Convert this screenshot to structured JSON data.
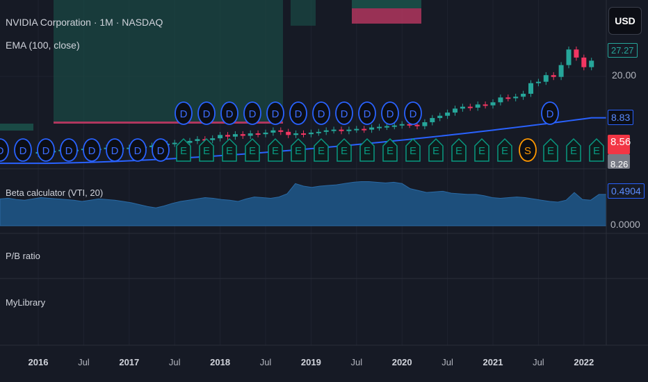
{
  "header": {
    "symbol_title": "NVIDIA Corporation · 1M · NASDAQ",
    "ema_label": "EMA (100, close)",
    "currency_button": "USD"
  },
  "price_axis": {
    "level_label": "20.00",
    "last_price_label": "27.27",
    "ema_value": "8.83",
    "red_label": "8.56",
    "gray_label": "8.26"
  },
  "beta_pane": {
    "title": "Beta calculator (VTI, 20)",
    "value_label": "0.4904",
    "zero_label": "0.0000"
  },
  "pb_pane": {
    "title": "P/B ratio"
  },
  "lib_pane": {
    "title": "MyLibrary"
  },
  "time_axis": [
    "2016",
    "Jul",
    "2017",
    "Jul",
    "2018",
    "Jul",
    "2019",
    "Jul",
    "2020",
    "Jul",
    "2021",
    "Jul",
    "2022"
  ],
  "colors": {
    "up": "#26a69a",
    "down": "#f23662",
    "ema": "#2962ff",
    "beta_fill": "#1d4f7c",
    "dividend": "#2962ff",
    "earnings": "#089981",
    "split": "#ff9800"
  },
  "chart_data": {
    "type": "candlestick",
    "start": "2016-01",
    "interval": "1M",
    "closes": [
      4.5,
      4.6,
      4.6,
      4.7,
      4.6,
      4.7,
      4.8,
      4.7,
      4.8,
      4.9,
      4.8,
      4.9,
      4.9,
      5.0,
      5.0,
      5.1,
      5.2,
      5.3,
      5.4,
      5.4,
      5.6,
      5.8,
      5.7,
      5.9,
      6.3,
      6.1,
      6.4,
      6.2,
      6.5,
      6.4,
      6.6,
      6.9,
      6.7,
      6.3,
      6.5,
      6.4,
      6.6,
      6.7,
      6.9,
      7.0,
      6.8,
      7.0,
      7.1,
      7.0,
      7.3,
      7.4,
      7.5,
      7.6,
      7.8,
      7.7,
      7.5,
      8.1,
      8.8,
      9.2,
      9.8,
      10.6,
      11.0,
      10.8,
      11.5,
      11.3,
      12.0,
      13.2,
      13.0,
      13.4,
      14.2,
      17.5,
      18.0,
      20.5,
      19.8,
      25.0,
      34.0,
      29.0,
      24.0,
      27.27
    ],
    "ema_start": 3.6,
    "ema_end": 8.83,
    "beta": [
      0.42,
      0.43,
      0.41,
      0.4,
      0.42,
      0.44,
      0.43,
      0.42,
      0.41,
      0.4,
      0.38,
      0.4,
      0.42,
      0.41,
      0.4,
      0.38,
      0.36,
      0.33,
      0.3,
      0.28,
      0.31,
      0.35,
      0.38,
      0.4,
      0.42,
      0.44,
      0.43,
      0.41,
      0.4,
      0.38,
      0.42,
      0.45,
      0.44,
      0.43,
      0.45,
      0.5,
      0.66,
      0.62,
      0.6,
      0.62,
      0.63,
      0.64,
      0.66,
      0.68,
      0.69,
      0.69,
      0.68,
      0.67,
      0.68,
      0.66,
      0.58,
      0.55,
      0.52,
      0.53,
      0.54,
      0.51,
      0.5,
      0.49,
      0.49,
      0.47,
      0.44,
      0.43,
      0.44,
      0.45,
      0.44,
      0.42,
      0.4,
      0.38,
      0.37,
      0.4,
      0.52,
      0.41,
      0.4,
      0.49
    ],
    "markers_bottom": [
      "D",
      "D",
      "D",
      "D",
      "D",
      "D",
      "D",
      "D",
      "E",
      "E",
      "E",
      "E",
      "E",
      "E",
      "E",
      "E",
      "E",
      "E",
      "E",
      "E",
      "E",
      "E",
      "E",
      "S",
      "E",
      "E",
      "E"
    ],
    "markers_top": [
      "D",
      "D",
      "D",
      "D",
      "D",
      "D",
      "D",
      "D",
      "D",
      "D",
      "D"
    ],
    "ylabel_ticks": [
      "20.00"
    ]
  }
}
